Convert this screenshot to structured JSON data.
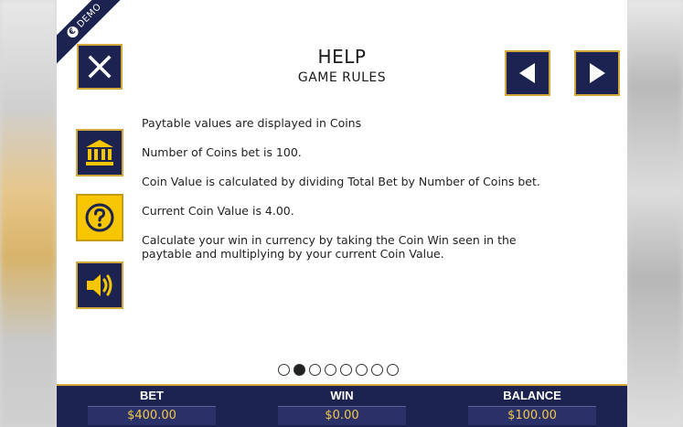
{
  "demo_badge": {
    "icon": "coin-icon",
    "label": "DEMO"
  },
  "header": {
    "title": "HELP",
    "subtitle": "GAME RULES"
  },
  "buttons": {
    "close": {
      "icon": "close-icon"
    },
    "prev": {
      "icon": "triangle-left-icon"
    },
    "next": {
      "icon": "triangle-right-icon"
    },
    "paytable": {
      "icon": "bank-icon"
    },
    "help": {
      "icon": "question-icon"
    },
    "sound": {
      "icon": "speaker-icon"
    }
  },
  "rules": [
    "Paytable values are displayed in Coins",
    "Number of Coins bet is 100.",
    "Coin Value is calculated by dividing Total Bet by Number of Coins bet.",
    "Current Coin Value is 4.00.",
    "Calculate your win in currency by taking the Coin Win seen in the paytable and multiplying by your current Coin Value."
  ],
  "pager": {
    "total": 8,
    "current": 2
  },
  "footer": {
    "bet": {
      "label": "BET",
      "value": "$400.00"
    },
    "win": {
      "label": "WIN",
      "value": "$0.00"
    },
    "balance": {
      "label": "BALANCE",
      "value": "$100.00"
    }
  },
  "colors": {
    "navy": "#1d2350",
    "gold": "#d4a93c",
    "yellow": "#f7c600",
    "value_text": "#f2c94c"
  }
}
